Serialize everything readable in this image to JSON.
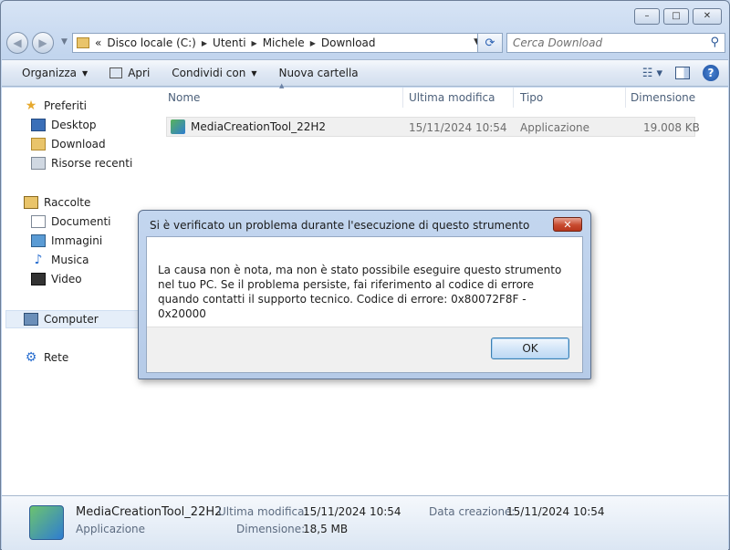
{
  "window": {
    "caption": {
      "minimize": "–",
      "maximize": "□",
      "close": "✕"
    }
  },
  "address_bar": {
    "prefix": "«",
    "crumbs": [
      "Disco locale (C:)",
      "Utenti",
      "Michele",
      "Download"
    ],
    "search_placeholder": "Cerca Download"
  },
  "toolbar": {
    "organize": "Organizza",
    "open": "Apri",
    "share": "Condividi con",
    "new_folder": "Nuova cartella"
  },
  "sidebar": {
    "favorites": "Preferiti",
    "desktop": "Desktop",
    "download": "Download",
    "recent": "Risorse recenti",
    "libraries": "Raccolte",
    "documents": "Documenti",
    "images": "Immagini",
    "music": "Musica",
    "video": "Video",
    "computer": "Computer",
    "network": "Rete"
  },
  "file_list": {
    "columns": {
      "name": "Nome",
      "modified": "Ultima modifica",
      "type": "Tipo",
      "size": "Dimensione"
    },
    "rows": [
      {
        "name": "MediaCreationTool_22H2",
        "modified": "15/11/2024 10:54",
        "type": "Applicazione",
        "size": "19.008 KB"
      }
    ]
  },
  "dialog": {
    "title": "Si è verificato un problema durante l'esecuzione di questo strumento",
    "message": "La causa non è nota, ma non è stato possibile eseguire questo strumento nel tuo PC. Se il problema persiste, fai riferimento al codice di errore quando contatti il supporto tecnico. Codice di errore: 0x80072F8F - 0x20000",
    "ok": "OK",
    "close": "✕"
  },
  "details": {
    "name": "MediaCreationTool_22H2",
    "type": "Applicazione",
    "modified_label": "Ultima modifica:",
    "modified_value": "15/11/2024 10:54",
    "created_label": "Data creazione:",
    "created_value": "15/11/2024 10:54",
    "size_label": "Dimensione:",
    "size_value": "18,5 MB"
  },
  "colors": {
    "window_frame": "#c2d5ee",
    "dialog_close": "#c84a2f",
    "ok_border": "#3c7fb1"
  }
}
